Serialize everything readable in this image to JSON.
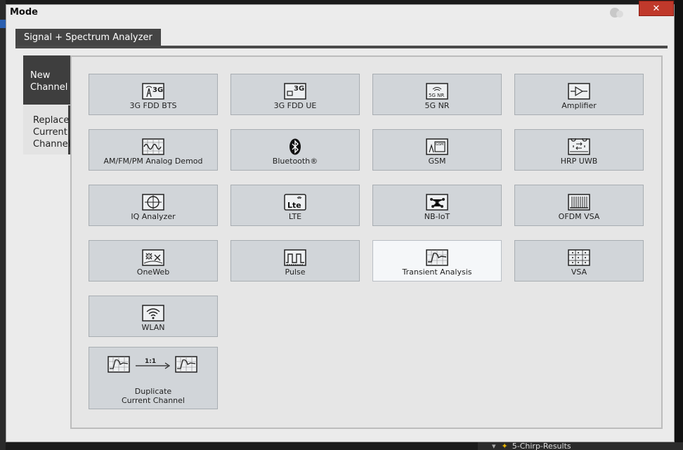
{
  "dialog": {
    "title": "Mode",
    "close_label": "✕"
  },
  "top_tab": {
    "label": "Signal + Spectrum Analyzer"
  },
  "side_tabs": [
    {
      "label_lines": [
        "New",
        "Channel"
      ]
    },
    {
      "label_lines": [
        "Replace",
        "Current",
        "Channel"
      ]
    }
  ],
  "tiles": [
    {
      "label": "3G FDD BTS",
      "icon": "3g-bts-icon"
    },
    {
      "label": "3G FDD UE",
      "icon": "3g-ue-icon"
    },
    {
      "label": "5G NR",
      "icon": "5g-nr-icon"
    },
    {
      "label": "Amplifier",
      "icon": "amplifier-icon"
    },
    {
      "label": "AM/FM/PM Analog Demod",
      "icon": "analog-demod-icon"
    },
    {
      "label": "Bluetooth®",
      "icon": "bluetooth-icon"
    },
    {
      "label": "GSM",
      "icon": "gsm-icon"
    },
    {
      "label": "HRP UWB",
      "icon": "hrp-uwb-icon"
    },
    {
      "label": "IQ Analyzer",
      "icon": "iq-analyzer-icon"
    },
    {
      "label": "LTE",
      "icon": "lte-icon"
    },
    {
      "label": "NB-IoT",
      "icon": "nb-iot-icon"
    },
    {
      "label": "OFDM VSA",
      "icon": "ofdm-vsa-icon"
    },
    {
      "label": "OneWeb",
      "icon": "oneweb-icon"
    },
    {
      "label": "Pulse",
      "icon": "pulse-icon"
    },
    {
      "label": "Transient Analysis",
      "icon": "transient-analysis-icon",
      "selected": true
    },
    {
      "label": "VSA",
      "icon": "vsa-icon"
    },
    {
      "label": "WLAN",
      "icon": "wlan-icon"
    }
  ],
  "duplicate_tile": {
    "label_lines": [
      "Duplicate",
      "Current Channel"
    ],
    "ratio": "1:1"
  },
  "icon_text": {
    "g3": "3G",
    "nr": "5G NR",
    "gsm": "GSM",
    "lte": "Lte"
  },
  "background": {
    "bottom_item": "5-Chirp-Results"
  },
  "colors": {
    "accent_dark": "#3e3e3e",
    "close_red": "#c0392b",
    "tile": "#d1d5d9",
    "tile_selected": "#f5f7f9"
  }
}
